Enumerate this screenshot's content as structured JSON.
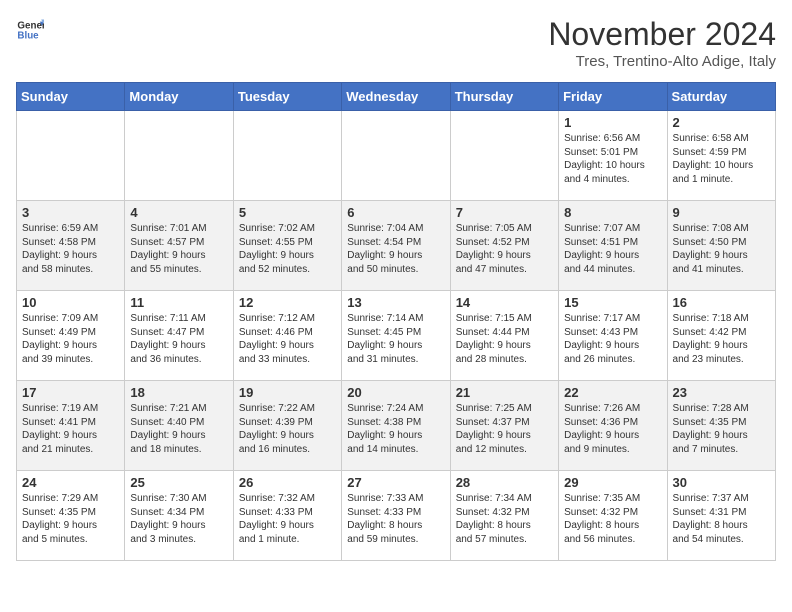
{
  "header": {
    "logo_general": "General",
    "logo_blue": "Blue",
    "month_title": "November 2024",
    "location": "Tres, Trentino-Alto Adige, Italy"
  },
  "weekdays": [
    "Sunday",
    "Monday",
    "Tuesday",
    "Wednesday",
    "Thursday",
    "Friday",
    "Saturday"
  ],
  "weeks": [
    [
      {
        "day": "",
        "info": ""
      },
      {
        "day": "",
        "info": ""
      },
      {
        "day": "",
        "info": ""
      },
      {
        "day": "",
        "info": ""
      },
      {
        "day": "",
        "info": ""
      },
      {
        "day": "1",
        "info": "Sunrise: 6:56 AM\nSunset: 5:01 PM\nDaylight: 10 hours\nand 4 minutes."
      },
      {
        "day": "2",
        "info": "Sunrise: 6:58 AM\nSunset: 4:59 PM\nDaylight: 10 hours\nand 1 minute."
      }
    ],
    [
      {
        "day": "3",
        "info": "Sunrise: 6:59 AM\nSunset: 4:58 PM\nDaylight: 9 hours\nand 58 minutes."
      },
      {
        "day": "4",
        "info": "Sunrise: 7:01 AM\nSunset: 4:57 PM\nDaylight: 9 hours\nand 55 minutes."
      },
      {
        "day": "5",
        "info": "Sunrise: 7:02 AM\nSunset: 4:55 PM\nDaylight: 9 hours\nand 52 minutes."
      },
      {
        "day": "6",
        "info": "Sunrise: 7:04 AM\nSunset: 4:54 PM\nDaylight: 9 hours\nand 50 minutes."
      },
      {
        "day": "7",
        "info": "Sunrise: 7:05 AM\nSunset: 4:52 PM\nDaylight: 9 hours\nand 47 minutes."
      },
      {
        "day": "8",
        "info": "Sunrise: 7:07 AM\nSunset: 4:51 PM\nDaylight: 9 hours\nand 44 minutes."
      },
      {
        "day": "9",
        "info": "Sunrise: 7:08 AM\nSunset: 4:50 PM\nDaylight: 9 hours\nand 41 minutes."
      }
    ],
    [
      {
        "day": "10",
        "info": "Sunrise: 7:09 AM\nSunset: 4:49 PM\nDaylight: 9 hours\nand 39 minutes."
      },
      {
        "day": "11",
        "info": "Sunrise: 7:11 AM\nSunset: 4:47 PM\nDaylight: 9 hours\nand 36 minutes."
      },
      {
        "day": "12",
        "info": "Sunrise: 7:12 AM\nSunset: 4:46 PM\nDaylight: 9 hours\nand 33 minutes."
      },
      {
        "day": "13",
        "info": "Sunrise: 7:14 AM\nSunset: 4:45 PM\nDaylight: 9 hours\nand 31 minutes."
      },
      {
        "day": "14",
        "info": "Sunrise: 7:15 AM\nSunset: 4:44 PM\nDaylight: 9 hours\nand 28 minutes."
      },
      {
        "day": "15",
        "info": "Sunrise: 7:17 AM\nSunset: 4:43 PM\nDaylight: 9 hours\nand 26 minutes."
      },
      {
        "day": "16",
        "info": "Sunrise: 7:18 AM\nSunset: 4:42 PM\nDaylight: 9 hours\nand 23 minutes."
      }
    ],
    [
      {
        "day": "17",
        "info": "Sunrise: 7:19 AM\nSunset: 4:41 PM\nDaylight: 9 hours\nand 21 minutes."
      },
      {
        "day": "18",
        "info": "Sunrise: 7:21 AM\nSunset: 4:40 PM\nDaylight: 9 hours\nand 18 minutes."
      },
      {
        "day": "19",
        "info": "Sunrise: 7:22 AM\nSunset: 4:39 PM\nDaylight: 9 hours\nand 16 minutes."
      },
      {
        "day": "20",
        "info": "Sunrise: 7:24 AM\nSunset: 4:38 PM\nDaylight: 9 hours\nand 14 minutes."
      },
      {
        "day": "21",
        "info": "Sunrise: 7:25 AM\nSunset: 4:37 PM\nDaylight: 9 hours\nand 12 minutes."
      },
      {
        "day": "22",
        "info": "Sunrise: 7:26 AM\nSunset: 4:36 PM\nDaylight: 9 hours\nand 9 minutes."
      },
      {
        "day": "23",
        "info": "Sunrise: 7:28 AM\nSunset: 4:35 PM\nDaylight: 9 hours\nand 7 minutes."
      }
    ],
    [
      {
        "day": "24",
        "info": "Sunrise: 7:29 AM\nSunset: 4:35 PM\nDaylight: 9 hours\nand 5 minutes."
      },
      {
        "day": "25",
        "info": "Sunrise: 7:30 AM\nSunset: 4:34 PM\nDaylight: 9 hours\nand 3 minutes."
      },
      {
        "day": "26",
        "info": "Sunrise: 7:32 AM\nSunset: 4:33 PM\nDaylight: 9 hours\nand 1 minute."
      },
      {
        "day": "27",
        "info": "Sunrise: 7:33 AM\nSunset: 4:33 PM\nDaylight: 8 hours\nand 59 minutes."
      },
      {
        "day": "28",
        "info": "Sunrise: 7:34 AM\nSunset: 4:32 PM\nDaylight: 8 hours\nand 57 minutes."
      },
      {
        "day": "29",
        "info": "Sunrise: 7:35 AM\nSunset: 4:32 PM\nDaylight: 8 hours\nand 56 minutes."
      },
      {
        "day": "30",
        "info": "Sunrise: 7:37 AM\nSunset: 4:31 PM\nDaylight: 8 hours\nand 54 minutes."
      }
    ]
  ]
}
